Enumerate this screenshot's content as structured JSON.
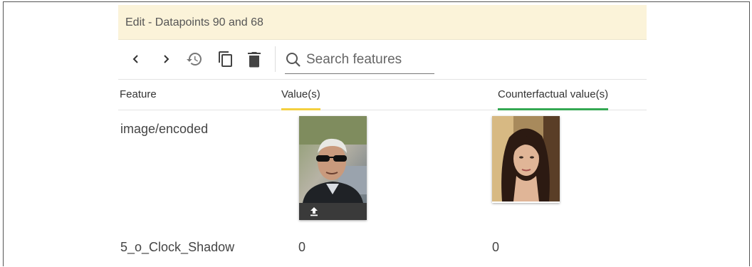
{
  "panel": {
    "title": "Edit - Datapoints 90 and 68"
  },
  "toolbar": {
    "search_placeholder": "Search features"
  },
  "columns": {
    "feature": "Feature",
    "values": "Value(s)",
    "counterfactual": "Counterfactual value(s)"
  },
  "rows": [
    {
      "feature": "image/encoded",
      "value": "",
      "counterfactual": ""
    },
    {
      "feature": "5_o_Clock_Shadow",
      "value": "0",
      "counterfactual": "0"
    }
  ],
  "colors": {
    "title_bg": "#fbf3d9",
    "value_accent": "#f4d03f",
    "counterfactual_accent": "#34a853"
  }
}
